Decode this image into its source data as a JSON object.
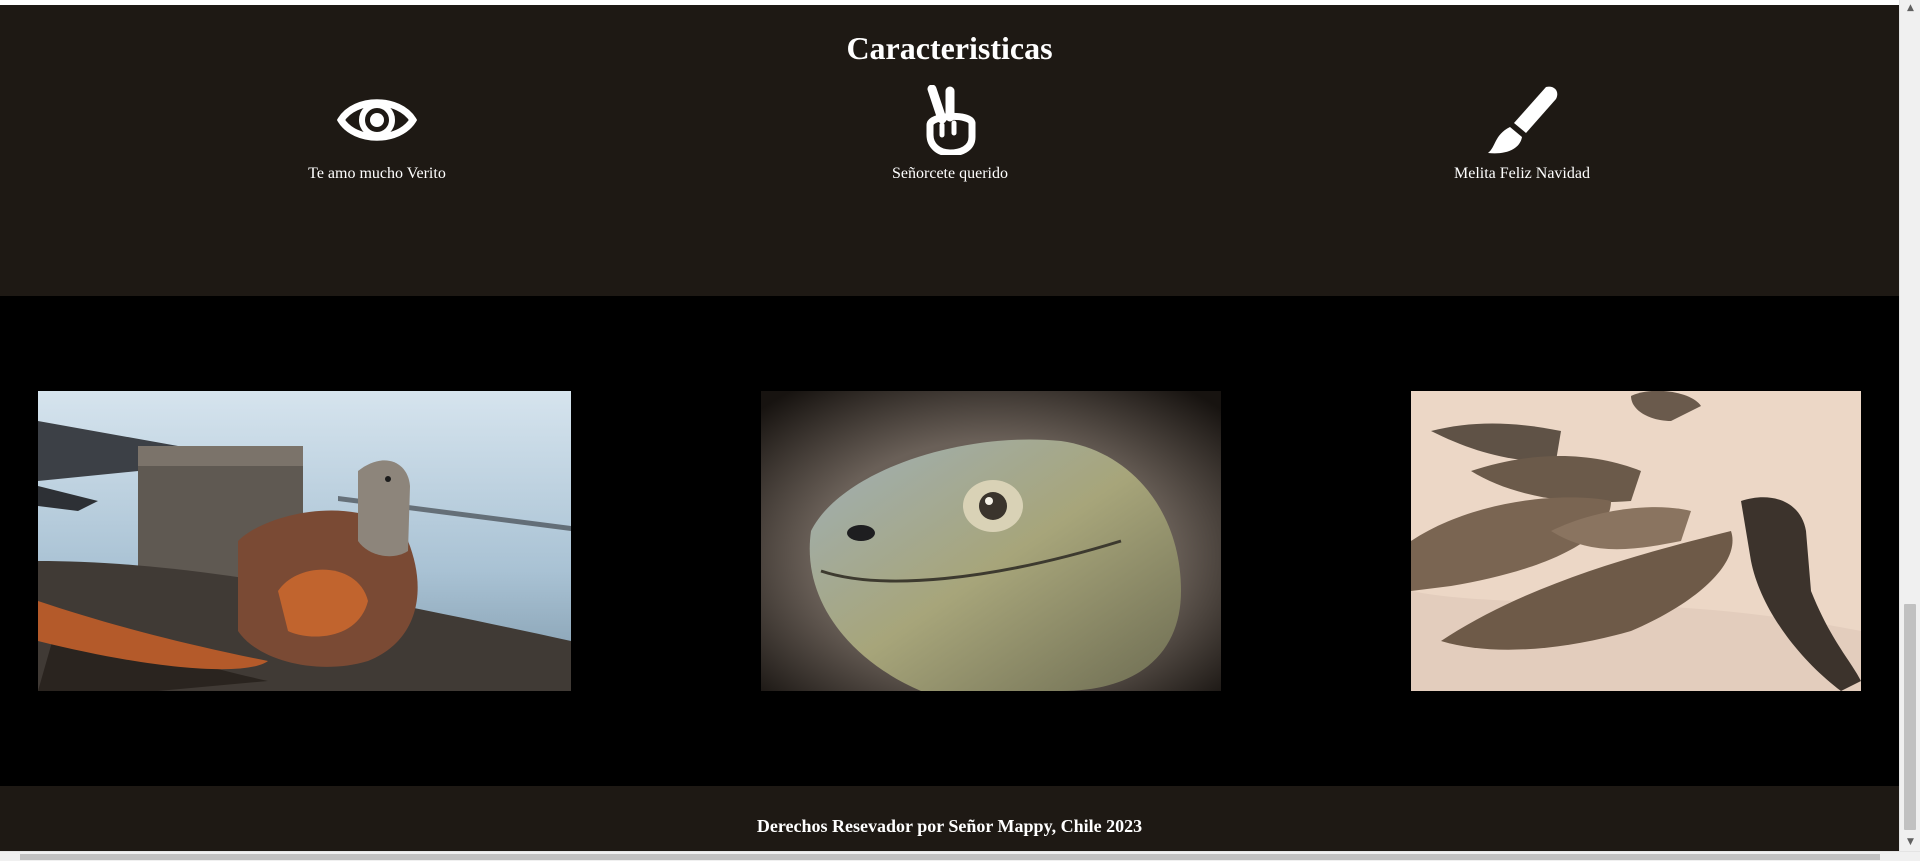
{
  "features": {
    "title": "Caracteristicas",
    "items": [
      {
        "icon": "eye-icon",
        "caption": "Te amo mucho Verito"
      },
      {
        "icon": "peace-hand-icon",
        "caption": "Señorcete querido"
      },
      {
        "icon": "paintbrush-icon",
        "caption": "Melita Feliz Navidad"
      }
    ]
  },
  "gallery": {
    "images": [
      {
        "subject": "iguana on rocks by water"
      },
      {
        "subject": "iguana head close-up"
      },
      {
        "subject": "group of iguanas on sand"
      }
    ]
  },
  "footer": {
    "text": "Derechos Resevador por Señor Mappy, Chile 2023"
  },
  "colors": {
    "section_bg": "#1e1914",
    "gallery_bg": "#000000",
    "text": "#ffffff"
  }
}
